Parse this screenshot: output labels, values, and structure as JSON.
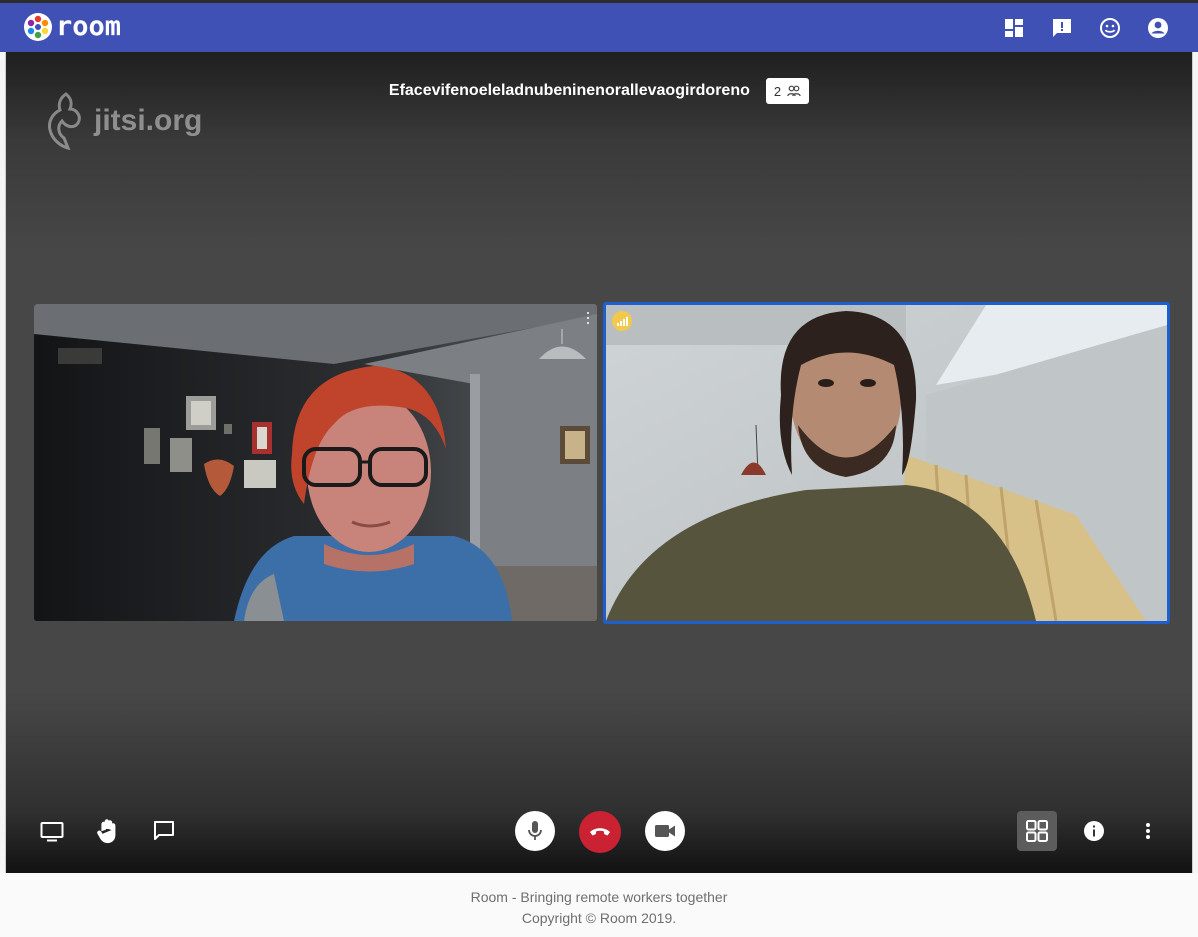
{
  "app": {
    "name": "room"
  },
  "appbar": {
    "icons": [
      "dashboard-icon",
      "feedback-icon",
      "smiley-icon",
      "account-circle-icon"
    ]
  },
  "conference": {
    "watermark": "jitsi.org",
    "subject": "Efacevifenoeleladnubeninenorallevaogirdoreno",
    "participant_count": "2"
  },
  "tiles": [
    {
      "name": "participant-tile-woman",
      "active_speaker": false
    },
    {
      "name": "participant-tile-man",
      "active_speaker": true,
      "connection_quality_color": "#f2c94c"
    }
  ],
  "toolbar": {
    "left": [
      "screen-share-icon",
      "raise-hand-icon",
      "chat-icon"
    ],
    "center": [
      "microphone-icon",
      "hangup-icon",
      "camera-icon"
    ],
    "right": [
      "tile-view-icon",
      "info-icon",
      "more-vert-icon"
    ]
  },
  "colors": {
    "appbar": "#3f51b5",
    "hangup": "#cb2233",
    "active_border": "#1d5fcf"
  },
  "footer": {
    "line1": "Room - Bringing remote workers together",
    "line2": "Copyright © Room 2019."
  }
}
